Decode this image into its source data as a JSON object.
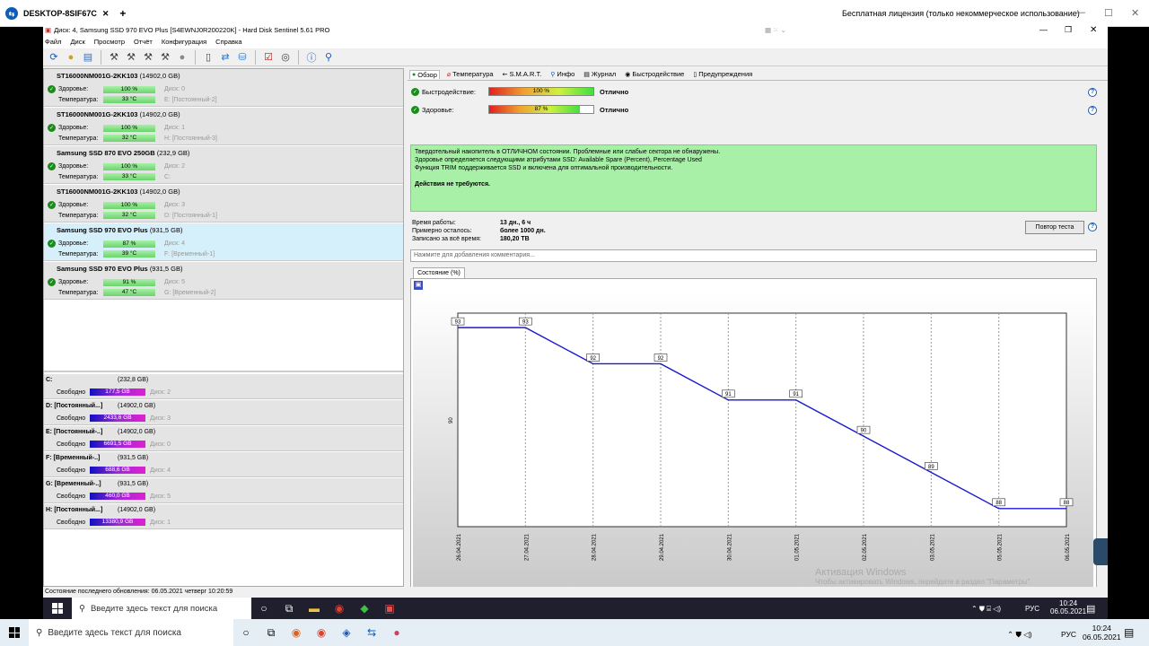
{
  "outer": {
    "tab_title": "DESKTOP-8SIF67C",
    "license_text": "Бесплатная лицензия (только некоммерческое использование)"
  },
  "app": {
    "title": "Диск: 4, Samsung SSD 970 EVO Plus [S4EWNJ0R200220K] - Hard Disk Sentinel 5.61 PRO",
    "menu": [
      "Файл",
      "Диск",
      "Просмотр",
      "Отчёт",
      "Конфигурация",
      "Справка"
    ]
  },
  "disks": [
    {
      "name": "ST16000NM001G-2KK103",
      "size": "(14902,0 GB)",
      "health_label": "Здоровье:",
      "health": "100 %",
      "disk": "Диск: 0",
      "temp_label": "Температура:",
      "temp": "33 °C",
      "vol": "E: [Постоянный-2]",
      "selected": false
    },
    {
      "name": "ST16000NM001G-2KK103",
      "size": "(14902,0 GB)",
      "health_label": "Здоровье:",
      "health": "100 %",
      "disk": "Диск: 1",
      "temp_label": "Температура:",
      "temp": "32 °C",
      "vol": "H: [Постоянный-3]",
      "selected": false
    },
    {
      "name": "Samsung SSD 870 EVO 250GB",
      "size": "(232,9 GB)",
      "health_label": "Здоровье:",
      "health": "100 %",
      "disk": "Диск: 2",
      "temp_label": "Температура:",
      "temp": "33 °C",
      "vol": "C:",
      "selected": false
    },
    {
      "name": "ST16000NM001G-2KK103",
      "size": "(14902,0 GB)",
      "health_label": "Здоровье:",
      "health": "100 %",
      "disk": "Диск: 3",
      "temp_label": "Температура:",
      "temp": "32 °C",
      "vol": "D: [Постоянный-1]",
      "selected": false
    },
    {
      "name": "Samsung SSD 970 EVO Plus",
      "size": "(931,5 GB)",
      "health_label": "Здоровье:",
      "health": "87 %",
      "disk": "Диск: 4",
      "temp_label": "Температура:",
      "temp": "39 °C",
      "vol": "F: [Временный-1]",
      "selected": true
    },
    {
      "name": "Samsung SSD 970 EVO Plus",
      "size": "(931,5 GB)",
      "health_label": "Здоровье:",
      "health": "91 %",
      "disk": "Диск: 5",
      "temp_label": "Температура:",
      "temp": "47 °C",
      "vol": "G: [Временный-2]",
      "selected": false
    }
  ],
  "volumes": [
    {
      "name": "C:",
      "size": "(232,8 GB)",
      "free_label": "Свободно",
      "free": "177,5 GB",
      "disk": "Диск: 2"
    },
    {
      "name": "D: [Постоянный...]",
      "size": "(14902,0 GB)",
      "free_label": "Свободно",
      "free": "2433,6 GB",
      "disk": "Диск: 3"
    },
    {
      "name": "E: [Постоянный-..]",
      "size": "(14902,0 GB)",
      "free_label": "Свободно",
      "free": "6691,5 GB",
      "disk": "Диск: 0"
    },
    {
      "name": "F: [Временный-..]",
      "size": "(931,5 GB)",
      "free_label": "Свободно",
      "free": "688,6 GB",
      "disk": "Диск: 4"
    },
    {
      "name": "G: [Временный-..]",
      "size": "(931,5 GB)",
      "free_label": "Свободно",
      "free": "460,0 GB",
      "disk": "Диск: 5"
    },
    {
      "name": "H: [Постоянный...]",
      "size": "(14902,0 GB)",
      "free_label": "Свободно",
      "free": "13380,9 GB",
      "disk": "Диск: 1"
    }
  ],
  "tabs": [
    "Обзор",
    "Температура",
    "S.M.A.R.T.",
    "Инфо",
    "Журнал",
    "Быстродействие",
    "Предупреждения"
  ],
  "overview": {
    "perf_label": "Быстродействие:",
    "perf_value": "100 %",
    "perf_fraction": 1.0,
    "perf_status": "Отлично",
    "health_label": "Здоровье:",
    "health_value": "87 %",
    "health_fraction": 0.87,
    "health_status": "Отлично",
    "summary_lines": [
      "Твердотельный накопитель в ОТЛИЧНОМ состоянии. Проблемные или слабые сектора не обнаружены.",
      "Здоровье определяется следующими атрибутами SSD: Available Spare (Percent), Percentage Used",
      "Функция TRIM поддерживается SSD и включена для оптимальной производительности."
    ],
    "summary_action": "Действия не требуются.",
    "uptime_label": "Время работы:",
    "uptime": "13 дн., 6 ч",
    "remaining_label": "Примерно осталось:",
    "remaining": "более 1000 дн.",
    "written_label": "Записано за всё время:",
    "written": "180,20 TB",
    "retest_button": "Повтор теста",
    "comment_placeholder": "Нажмите для добавления комментария...",
    "chart_tab": "Состояние (%)"
  },
  "chart_data": {
    "type": "line",
    "x": [
      "26.04.2021",
      "27.04.2021",
      "28.04.2021",
      "29.04.2021",
      "30.04.2021",
      "01.05.2021",
      "02.05.2021",
      "03.05.2021",
      "05.05.2021",
      "06.05.2021"
    ],
    "values": [
      93,
      93,
      92,
      92,
      91,
      91,
      90,
      89,
      88,
      88
    ],
    "ylabel": "90",
    "ylim": [
      87.5,
      93.4
    ],
    "color": "#1a1ad0"
  },
  "status_text": "Состояние последнего обновления: 06.05.2021 четверг 10:20:59",
  "watermark": {
    "line1": "Активация Windows",
    "line2": "Чтобы активировать Windows, перейдите в раздел \"Параметры\"."
  },
  "inner_taskbar": {
    "search": "Введите здесь текст для поиска",
    "lang": "РУС",
    "time": "10:24",
    "date": "06.05.2021"
  },
  "outer_taskbar": {
    "search": "Введите здесь текст для поиска",
    "lang": "РУС",
    "time": "10:24",
    "date": "06.05.2021"
  }
}
